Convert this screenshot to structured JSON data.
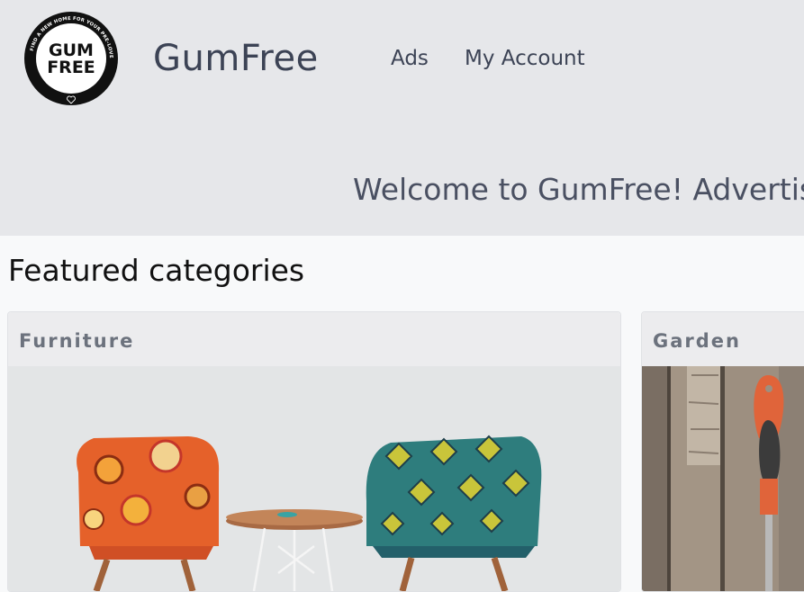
{
  "header": {
    "logo": {
      "text_line1": "GUM",
      "text_line2": "FREE",
      "ring_text": "FIND A NEW HOME FOR YOUR PRE-LOVED STUFF",
      "icon": "heart-icon"
    },
    "brand": "GumFree",
    "nav": [
      {
        "label": "Ads"
      },
      {
        "label": "My Account"
      }
    ],
    "welcome": "Welcome to GumFree! Advertise"
  },
  "main": {
    "section_title": "Featured categories",
    "categories": [
      {
        "title": "Furniture",
        "image": "chairs-photo"
      },
      {
        "title": "Garden",
        "image": "garden-tool-photo"
      }
    ]
  },
  "colors": {
    "header_bg": "#e6e7ea",
    "page_bg": "#f8f9fa",
    "brand_text": "#3c4355",
    "card_header_text": "#6c727d"
  }
}
